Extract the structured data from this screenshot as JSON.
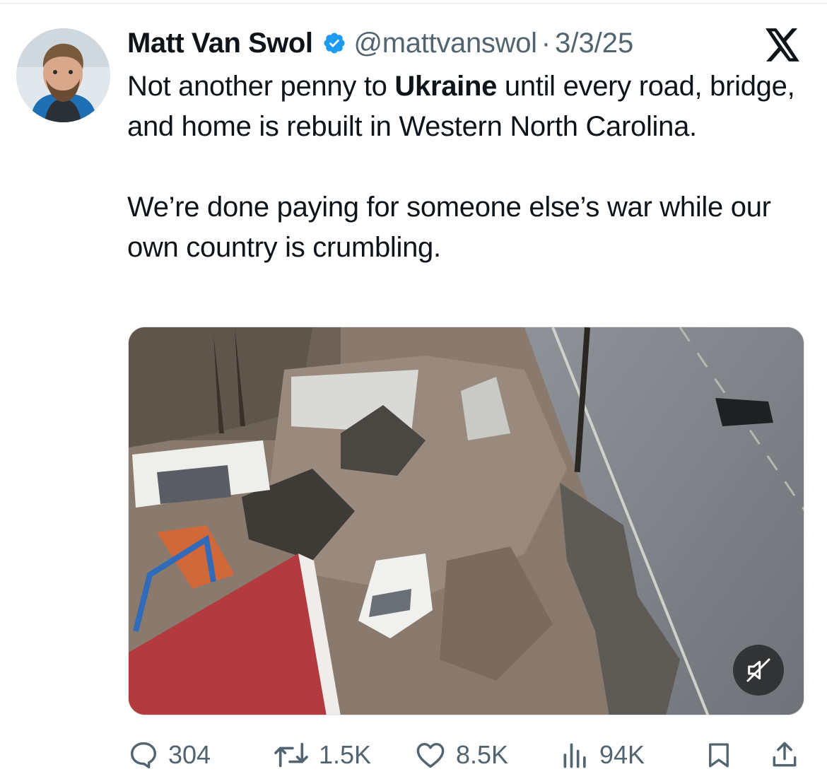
{
  "tweet": {
    "author": {
      "name": "Matt Van Swol",
      "handle": "@mattvanswol",
      "verified": true,
      "avatar": "avatar-photo"
    },
    "separator": "·",
    "date": "3/3/25",
    "platform_icon": "x-logo-icon",
    "text": {
      "p1_before": "Not another penny to ",
      "p1_bold": "Ukraine",
      "p1_after": " until every road, bridge, and home is rebuilt in Western North Carolina.",
      "p2": "We’re done paying for someone else’s war while our own country is crumbling."
    },
    "media": {
      "type": "video",
      "mute_icon": "muted-speaker-icon"
    },
    "actions": {
      "replies": "304",
      "reposts": "1.5K",
      "likes": "8.5K",
      "views": "94K"
    }
  },
  "colors": {
    "text": "#0f1419",
    "secondary": "#536471",
    "verified": "#1d9bf0"
  }
}
